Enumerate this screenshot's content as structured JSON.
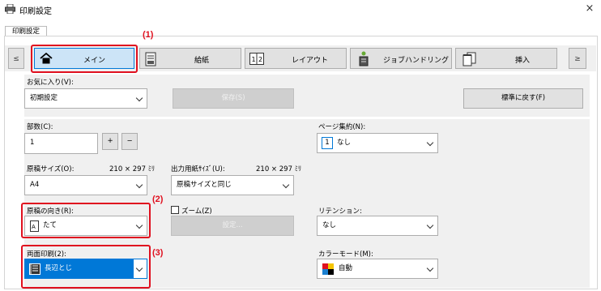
{
  "window": {
    "title": "印刷設定",
    "close": "×"
  },
  "tabs": [
    {
      "label": "印刷設定"
    }
  ],
  "toolbar": {
    "prev": "≤",
    "next": "≥",
    "items": [
      {
        "label": "メイン",
        "icon": "home-icon"
      },
      {
        "label": "給紙",
        "icon": "paper-tray-icon"
      },
      {
        "label": "レイアウト",
        "icon": "layout-icon"
      },
      {
        "label": "ジョブハンドリング",
        "icon": "job-handling-icon"
      },
      {
        "label": "挿入",
        "icon": "insert-icon"
      }
    ]
  },
  "favorites": {
    "label": "お気に入り(V):",
    "value": "初期設定",
    "save": "保存(S)",
    "reset": "標準に戻す(F)"
  },
  "copies": {
    "label": "部数(C):",
    "value": "1",
    "plus": "+",
    "minus": "−"
  },
  "original_size": {
    "label": "原稿サイズ(O):",
    "dims": "210 × 297 ﾐﾘ",
    "value": "A4"
  },
  "output_size": {
    "label": "出力用紙ｻｲｽﾞ(U):",
    "dims": "210 × 297 ﾐﾘ",
    "value": "原稿サイズと同じ"
  },
  "orientation": {
    "label": "原稿の向き(R):",
    "value": "たて"
  },
  "zoom": {
    "label": "ズーム(Z)",
    "settings": "設定..."
  },
  "duplex": {
    "label": "両面印刷(2):",
    "value": "長辺とじ"
  },
  "nup": {
    "label": "ページ集約(N):",
    "value": "なし",
    "badge": "1"
  },
  "retention": {
    "label": "リテンション:",
    "value": "なし"
  },
  "color_mode": {
    "label": "カラーモード(M):",
    "value": "自動"
  },
  "callouts": {
    "c1": "(1)",
    "c2": "(2)",
    "c3": "(3)"
  },
  "colors": {
    "accent": "#0078d7",
    "callout": "#e0101f",
    "selected": "#cce4f7"
  }
}
